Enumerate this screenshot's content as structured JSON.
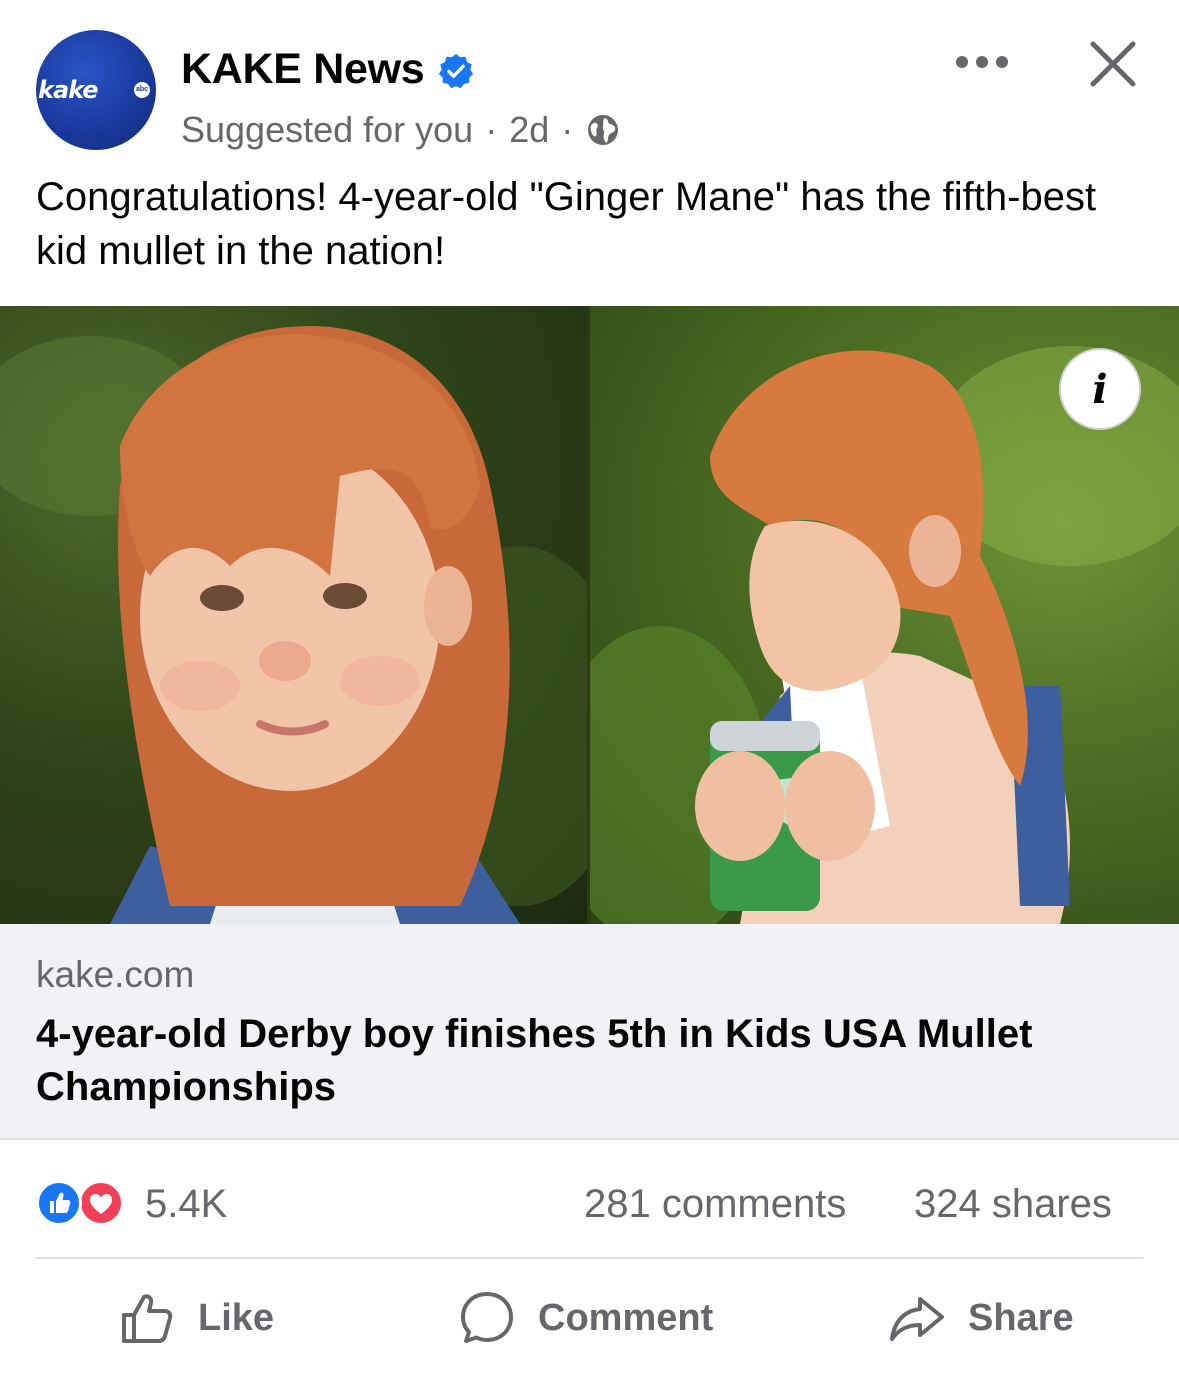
{
  "post": {
    "page_name": "KAKE News",
    "avatar_text": "kake",
    "avatar_badge": "abc",
    "subline": {
      "suggested": "Suggested for you",
      "separator": "·",
      "time": "2d"
    },
    "caption": "Congratulations! 4-year-old \"Ginger Mane\" has the fifth-best kid mullet in the nation!",
    "info_label": "i"
  },
  "link_preview": {
    "domain": "kake.com",
    "title": "4-year-old Derby boy finishes 5th in Kids USA Mullet Championships"
  },
  "stats": {
    "reactions_count": "5.4K",
    "comments": "281 comments",
    "shares": "324 shares"
  },
  "actions": {
    "like": "Like",
    "comment": "Comment",
    "share": "Share"
  },
  "colors": {
    "brand_blue": "#1877f2",
    "love_red": "#f33e58",
    "secondary_text": "#65676b",
    "preview_bg": "#f0f2f5",
    "avatar_blue": "#1a3a9e"
  },
  "icons": [
    "verified-badge-icon",
    "globe-icon",
    "more-options-icon",
    "close-icon",
    "info-icon",
    "like-reaction-icon",
    "love-reaction-icon",
    "thumbs-up-icon",
    "comment-bubble-icon",
    "share-arrow-icon"
  ]
}
